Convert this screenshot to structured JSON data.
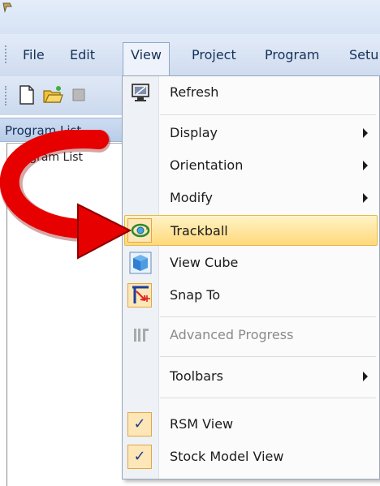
{
  "menubar": {
    "items": [
      {
        "label": "File"
      },
      {
        "label": "Edit"
      },
      {
        "label": "View"
      },
      {
        "label": "Project"
      },
      {
        "label": "Program"
      },
      {
        "label": "Setu"
      }
    ]
  },
  "panel": {
    "header": "Program List",
    "column_header": "Program List"
  },
  "view_menu": {
    "items": {
      "refresh": {
        "label": "Refresh"
      },
      "display": {
        "label": "Display"
      },
      "orientation": {
        "label": "Orientation"
      },
      "modify": {
        "label": "Modify"
      },
      "trackball": {
        "label": "Trackball"
      },
      "view_cube": {
        "label": "View Cube"
      },
      "snap_to": {
        "label": "Snap To"
      },
      "advanced_progress": {
        "label": "Advanced Progress"
      },
      "toolbars": {
        "label": "Toolbars"
      },
      "rsm_view": {
        "label": "RSM View",
        "checked": true
      },
      "stock_model_view": {
        "label": "Stock Model View",
        "checked": true
      }
    }
  },
  "icons": {
    "refresh": "monitor-refresh-icon",
    "trackball": "trackball-icon",
    "view_cube": "view-cube-icon",
    "snap_to": "snap-to-icon",
    "advanced_progress": "progress-bars-icon"
  },
  "colors": {
    "highlight": "#ffd97a",
    "arrow": "#e60000",
    "menu_text": "#15315a"
  }
}
